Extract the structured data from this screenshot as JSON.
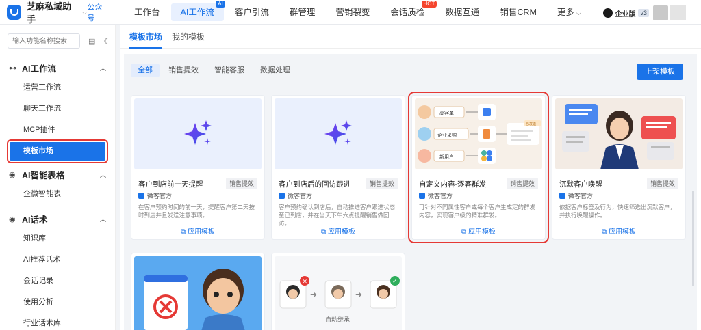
{
  "brand": {
    "name": "芝麻私域助手",
    "link": "公众号"
  },
  "nav": [
    {
      "label": "工作台",
      "active": false,
      "badge": ""
    },
    {
      "label": "AI工作流",
      "active": true,
      "badge": "AI"
    },
    {
      "label": "客户引流",
      "active": false,
      "badge": ""
    },
    {
      "label": "群管理",
      "active": false,
      "badge": ""
    },
    {
      "label": "营销裂变",
      "active": false,
      "badge": ""
    },
    {
      "label": "会话质检",
      "active": false,
      "badge": "HOT"
    },
    {
      "label": "数据互通",
      "active": false,
      "badge": ""
    },
    {
      "label": "销售CRM",
      "active": false,
      "badge": ""
    },
    {
      "label": "更多",
      "active": false,
      "badge": ""
    }
  ],
  "top_right": {
    "edition": "企业版",
    "version": "v3"
  },
  "sidebar": {
    "search_placeholder": "输入功能名称搜索",
    "groups": [
      {
        "title": "AI工作流",
        "items": [
          "运营工作流",
          "聊天工作流",
          "MCP插件",
          "模板市场"
        ]
      },
      {
        "title": "AI智能表格",
        "items": [
          "企微智能表"
        ]
      },
      {
        "title": "AI话术",
        "items": [
          "知识库",
          "AI推荐话术",
          "会话记录",
          "使用分析",
          "行业话术库"
        ]
      }
    ],
    "active_item": "模板市场"
  },
  "main": {
    "tabs": [
      "模板市场",
      "我的模板"
    ],
    "filters": [
      "全部",
      "销售提效",
      "智能客服",
      "数据处理"
    ],
    "upload_label": "上架模板",
    "source_label": "微客官方",
    "apply_label": "应用模板",
    "cards": [
      {
        "title": "客户到店前一天提醒",
        "tag": "销售提效",
        "desc": "在客户预约时间的前一天，提醒客户第二天按时到店并且发送注意事项。"
      },
      {
        "title": "客户到店后的回访跟进",
        "tag": "销售提效",
        "desc": "客户预约确认到店后，自动推进客户跟进状态至已到店，并在当天下午六点提醒销售做回访。"
      },
      {
        "title": "自定义内容-逐客群发",
        "tag": "销售提效",
        "desc": "可针对不同属性客户或每个客户生成定的群发内容，实现客户级的精准群发。"
      },
      {
        "title": "沉默客户唤醒",
        "tag": "销售提效",
        "desc": "依据客户标签及行为，快速筛选出沉默客户，并执行唤醒操作。"
      }
    ],
    "flow_labels": [
      "高客单",
      "企业采购",
      "新用户",
      "已发送"
    ],
    "inherit_label": "自动继承"
  }
}
